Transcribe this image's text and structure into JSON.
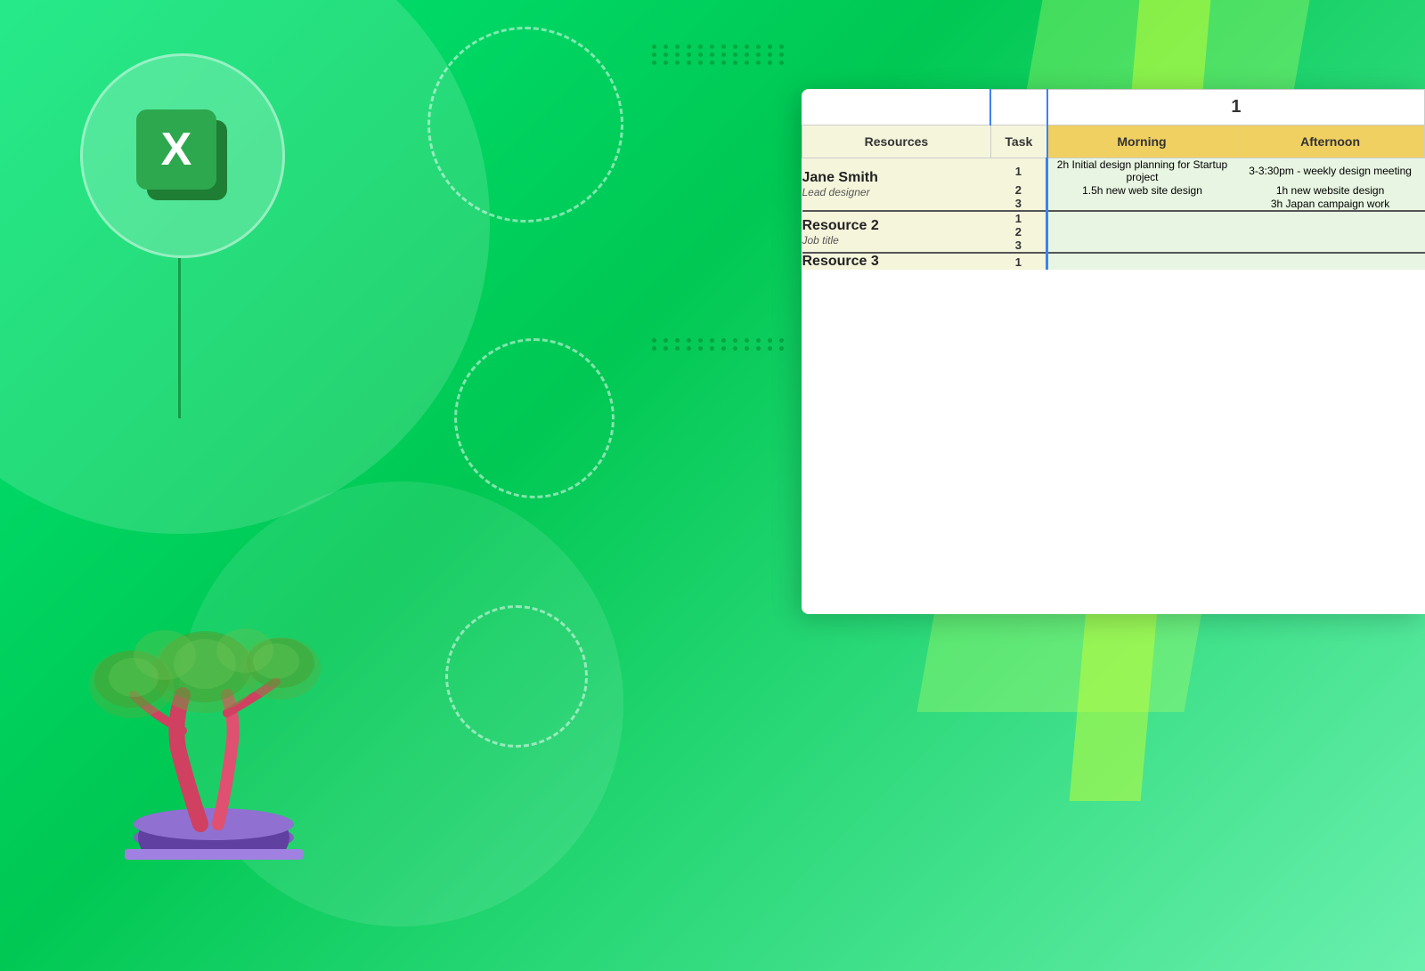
{
  "background": {
    "color": "#00c853"
  },
  "excel_icon": {
    "letter": "X"
  },
  "spreadsheet": {
    "day_number": "1",
    "columns": {
      "resources": "Resources",
      "task": "Task",
      "morning": "Morning",
      "afternoon": "Afternoon"
    },
    "rows": [
      {
        "resource_name": "Jane Smith",
        "resource_title": "Lead designer",
        "tasks": [
          {
            "task_num": "1",
            "morning": "2h Initial design planning for Startup project",
            "afternoon": "3-3:30pm - weekly design meeting"
          },
          {
            "task_num": "2",
            "morning": "1.5h new web site design",
            "afternoon": "1h new website design"
          },
          {
            "task_num": "3",
            "morning": "",
            "afternoon": "3h Japan campaign work"
          }
        ]
      },
      {
        "resource_name": "Resource 2",
        "resource_title": "Job title",
        "tasks": [
          {
            "task_num": "1",
            "morning": "",
            "afternoon": ""
          },
          {
            "task_num": "2",
            "morning": "",
            "afternoon": ""
          },
          {
            "task_num": "3",
            "morning": "",
            "afternoon": ""
          }
        ]
      },
      {
        "resource_name": "Resource 3",
        "resource_title": "",
        "tasks": [
          {
            "task_num": "1",
            "morning": "",
            "afternoon": ""
          }
        ]
      }
    ]
  }
}
